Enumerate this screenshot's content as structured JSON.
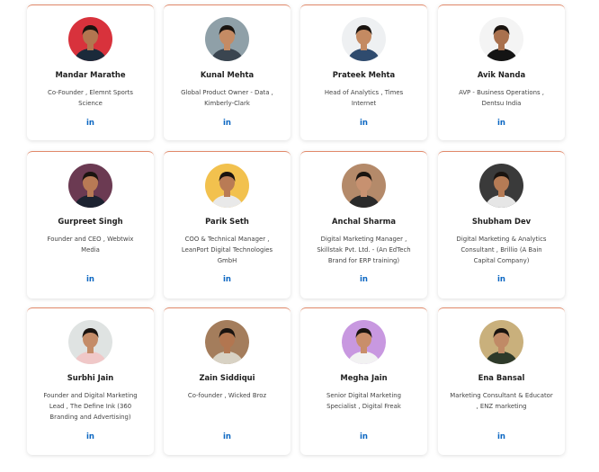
{
  "colors": {
    "card_border": "#e2896a",
    "linkedin": "#0a66c2",
    "name": "#1f1f1f",
    "role": "#444444"
  },
  "linkedin_icon": "linkedin-icon",
  "linkedin_label": "in",
  "speakers": [
    {
      "name": "Mandar Marathe",
      "role": "Co-Founder , Elemnt Sports Science",
      "avatar_bg": "#d8323c",
      "skin": "#b27650",
      "shirt": "#1b2a3a"
    },
    {
      "name": "Kunal Mehta",
      "role": "Global Product Owner - Data , Kimberly-Clark",
      "avatar_bg": "#8fa0a8",
      "skin": "#c58b64",
      "shirt": "#3a4550"
    },
    {
      "name": "Prateek Mehta",
      "role": "Head of Analytics , Times Internet",
      "avatar_bg": "#eef0f2",
      "skin": "#c48a62",
      "shirt": "#2f4b6e"
    },
    {
      "name": "Avik Nanda",
      "role": "AVP - Business Operations , Dentsu India",
      "avatar_bg": "#f4f4f4",
      "skin": "#a9714e",
      "shirt": "#141414"
    },
    {
      "name": "Gurpreet Singh",
      "role": "Founder and CEO , Webtwix Media",
      "avatar_bg": "#6b3a52",
      "skin": "#b87a55",
      "shirt": "#1c2230"
    },
    {
      "name": "Parik Seth",
      "role": "COO & Technical Manager , LeanPort Digital Technologies GmbH",
      "avatar_bg": "#f2c14e",
      "skin": "#b97b55",
      "shirt": "#e9e9e9"
    },
    {
      "name": "Anchal Sharma",
      "role": "Digital Marketing Manager , Skillstak Pvt. Ltd. - (An EdTech Brand for ERP training)",
      "avatar_bg": "#b48a6a",
      "skin": "#c79170",
      "shirt": "#2a2a2a"
    },
    {
      "name": "Shubham Dev",
      "role": "Digital Marketing & Analytics Consultant , Brillio (A Bain Capital Company)",
      "avatar_bg": "#3a3a3a",
      "skin": "#b57b55",
      "shirt": "#e6e6e6"
    },
    {
      "name": "Surbhi Jain",
      "role": "Founder and Digital Marketing Lead , The Define Ink (360 Branding and Advertising)",
      "avatar_bg": "#dfe3e2",
      "skin": "#c48c68",
      "shirt": "#f0c8c8"
    },
    {
      "name": "Zain Siddiqui",
      "role": "Co-founder , Wicked Broz",
      "avatar_bg": "#a47d5c",
      "skin": "#b27650",
      "shirt": "#d8d2c4"
    },
    {
      "name": "Megha Jain",
      "role": "Senior Digital Marketing Specialist , Digital Freak",
      "avatar_bg": "#c898e0",
      "skin": "#c98e6a",
      "shirt": "#f2f2f2"
    },
    {
      "name": "Ena Bansal",
      "role": "Marketing Consultant & Educator , ENZ marketing",
      "avatar_bg": "#c9b07c",
      "skin": "#c08a66",
      "shirt": "#2e3a2a"
    }
  ]
}
